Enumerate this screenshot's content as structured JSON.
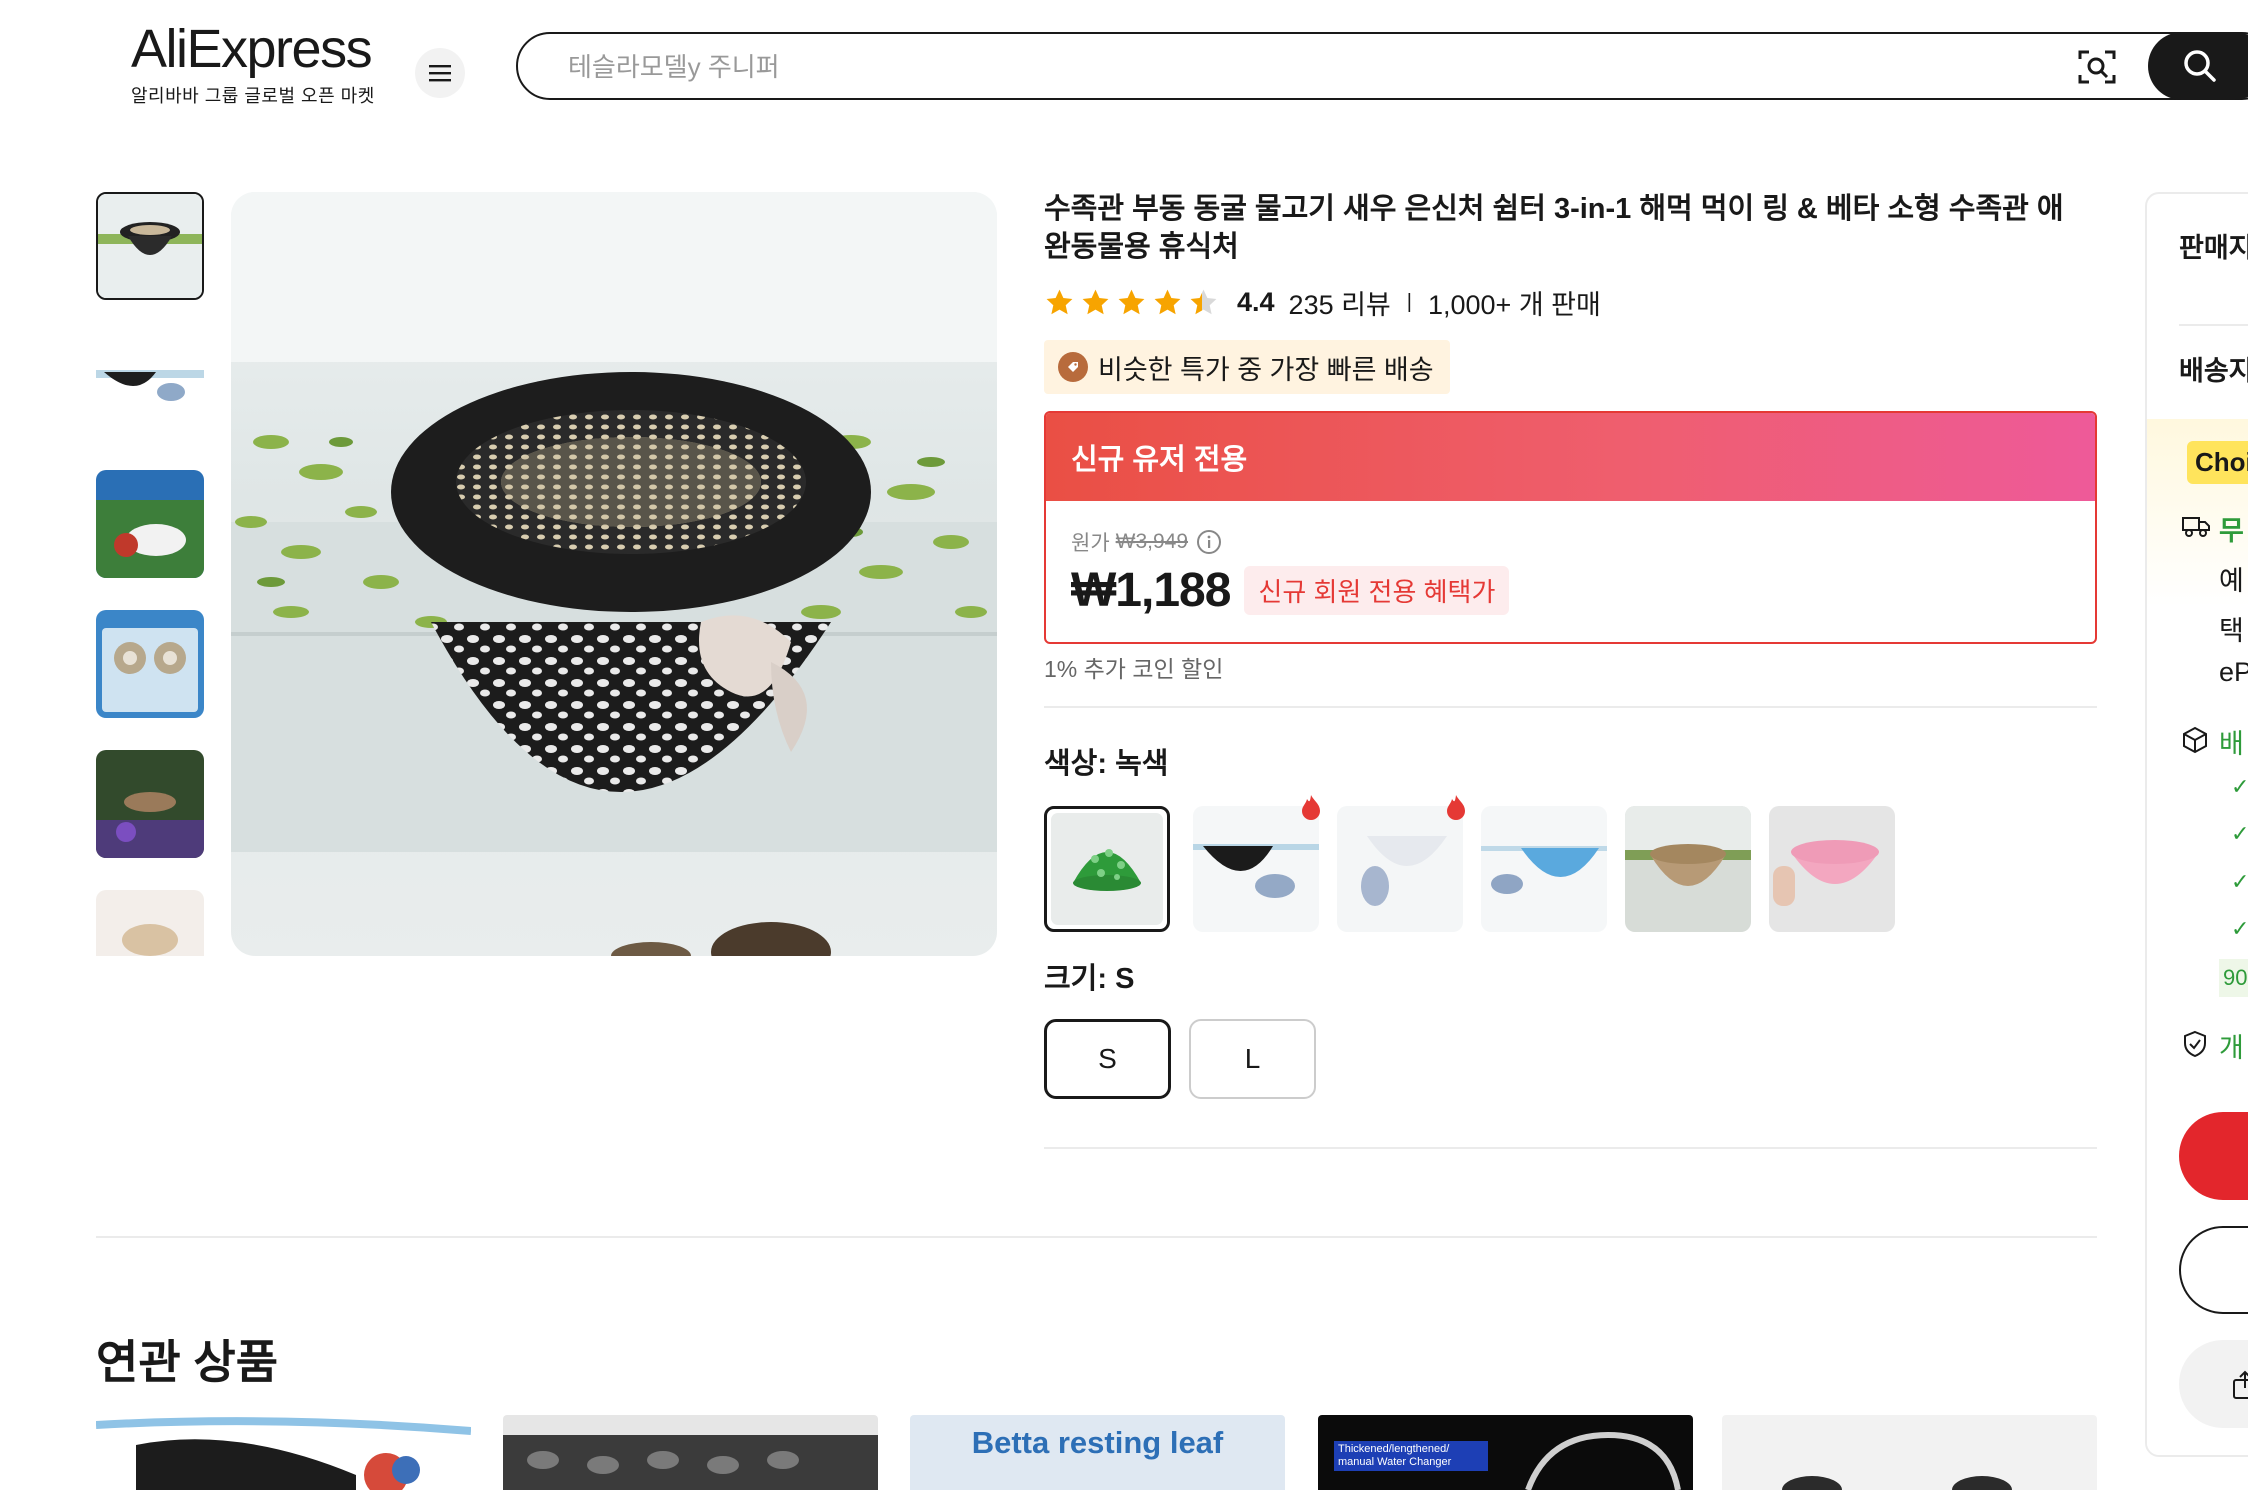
{
  "header": {
    "logo_text": "AliExpress",
    "logo_tagline": "알리바바 그룹 글로벌 오픈 마켓",
    "search_placeholder": "테슬라모델y 주니퍼"
  },
  "product": {
    "title": "수족관 부동 동굴 물고기 새우 은신처 쉼터 3-in-1 해먹 먹이 링 & 베타 소형 수족관 애완동물용 휴식처",
    "rating": "4.4",
    "rating_stars": 4.4,
    "reviews": "235 리뷰",
    "sold": "1,000+ 개 판매",
    "promo_tag": "비슷한 특가 중 가장 빠른 배송"
  },
  "price_card": {
    "header": "신규 유저 전용",
    "original_label": "원가",
    "original_price": "₩3,949",
    "price": "₩1,188",
    "badge": "신규 회원 전용 혜택가"
  },
  "coin_note": "1% 추가 코인 할인",
  "color": {
    "label": "색상: 녹색",
    "options": [
      {
        "name": "green",
        "selected": true,
        "hot": false
      },
      {
        "name": "black",
        "selected": false,
        "hot": true
      },
      {
        "name": "white",
        "selected": false,
        "hot": true
      },
      {
        "name": "blue",
        "selected": false,
        "hot": false
      },
      {
        "name": "khaki",
        "selected": false,
        "hot": false
      },
      {
        "name": "pink",
        "selected": false,
        "hot": false
      }
    ]
  },
  "size": {
    "label": "크기: S",
    "options": [
      {
        "label": "S",
        "selected": true
      },
      {
        "label": "L",
        "selected": false
      }
    ]
  },
  "related": {
    "title": "연관 상품",
    "cards": [
      {
        "caption": ""
      },
      {
        "caption": ""
      },
      {
        "caption": "Betta resting leaf"
      },
      {
        "caption": "Thickened/lengthened/ manual Water Changer"
      },
      {
        "caption": ""
      }
    ]
  },
  "right_panel": {
    "seller": "판매지",
    "ship_to": "배송지",
    "choice": "Choic",
    "free": "무",
    "line_1": "예",
    "line_2": "택",
    "line_3": "eP",
    "delivery": "배",
    "days_chip": "90",
    "protection": "개"
  },
  "colors": {
    "accent_red": "#e53935",
    "star": "#f7a400",
    "choice_yellow": "#ffe45c",
    "green": "#2e9b3a"
  }
}
